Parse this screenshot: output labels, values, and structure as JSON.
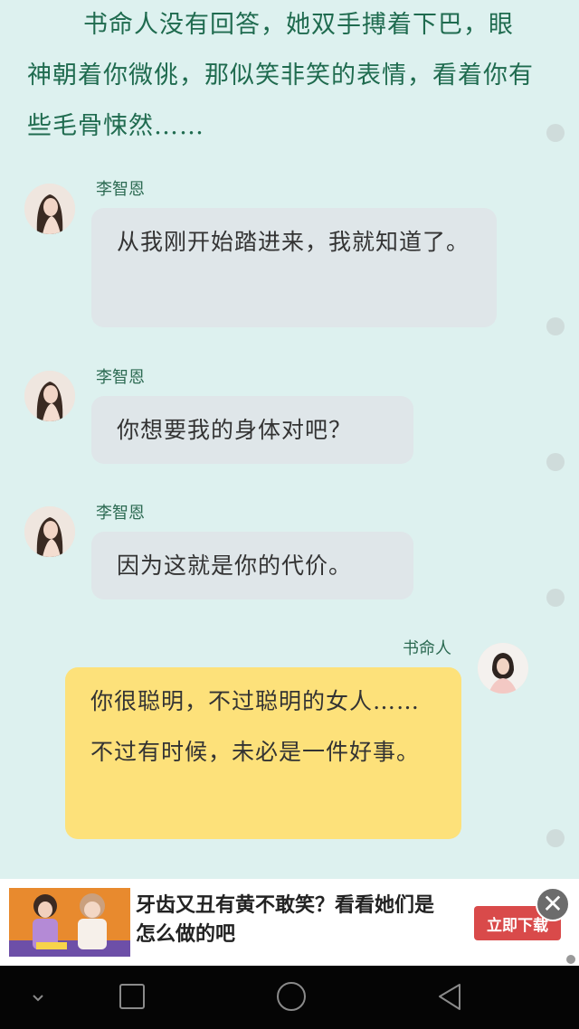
{
  "narration": "书命人没有回答，她双手搏着下巴，眼神朝着你微佻，那似笑非笑的表情，看着你有些毛骨悚然……",
  "messages": [
    {
      "sender": "李智恩",
      "text": "从我刚开始踏进来，我就知道了。",
      "side": "left"
    },
    {
      "sender": "李智恩",
      "text": "你想要我的身体对吧？",
      "side": "left"
    },
    {
      "sender": "李智恩",
      "text": "因为这就是你的代价。",
      "side": "left"
    },
    {
      "sender": "书命人",
      "text": "你很聪明，不过聪明的女人……不过有时候，未必是一件好事。",
      "side": "right"
    }
  ],
  "ad": {
    "text": "牙齿又丑有黄不敢笑？看看她们是怎么做的吧",
    "button": "立即下载",
    "close": "✕"
  },
  "navbar": {
    "items": [
      "collapse-chevron",
      "overview",
      "home",
      "back"
    ]
  },
  "colors": {
    "background": "#ddf1ef",
    "left_bubble": "#dfe6e9",
    "right_bubble": "#fde17a",
    "narration": "#1f6b4f",
    "ad_button": "#d94a4a"
  }
}
